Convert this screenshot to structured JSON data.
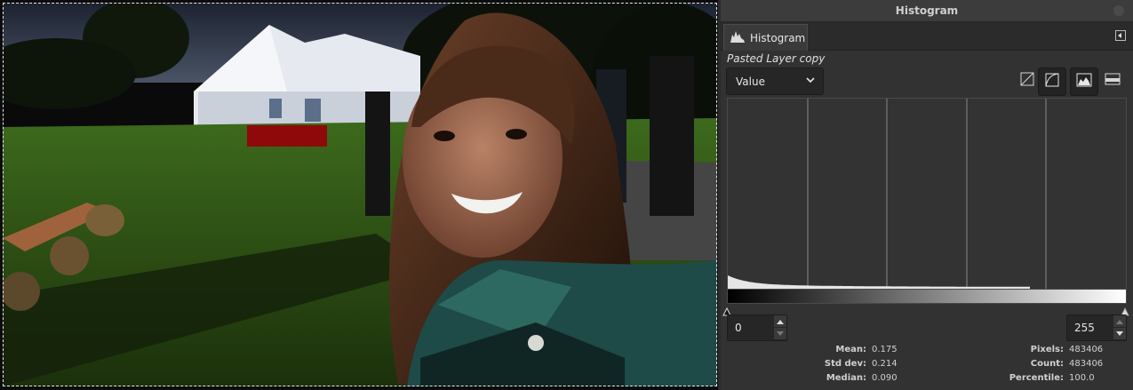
{
  "canvas": {
    "description_name": "photo-canvas"
  },
  "dock": {
    "title": "Histogram",
    "tab_label": "Histogram",
    "layer_name": "Pasted Layer copy",
    "channel": {
      "selected": "Value"
    },
    "modes": [
      {
        "name": "linear-histogram-icon",
        "active": false
      },
      {
        "name": "logarithmic-histogram-icon",
        "active": true
      },
      {
        "name": "histogram-mode-icon",
        "active": true
      },
      {
        "name": "histogram-view-icon",
        "active": false
      }
    ],
    "range": {
      "low": "0",
      "high": "255"
    },
    "stats_left": [
      {
        "label": "Mean:",
        "value": "0.175"
      },
      {
        "label": "Std dev:",
        "value": "0.214"
      },
      {
        "label": "Median:",
        "value": "0.090"
      }
    ],
    "stats_right": [
      {
        "label": "Pixels:",
        "value": "483406"
      },
      {
        "label": "Count:",
        "value": "483406"
      },
      {
        "label": "Percentile:",
        "value": "100.0"
      }
    ]
  },
  "colors": {
    "accent": "#323232",
    "histogram_bars": "#e6e6e6"
  }
}
